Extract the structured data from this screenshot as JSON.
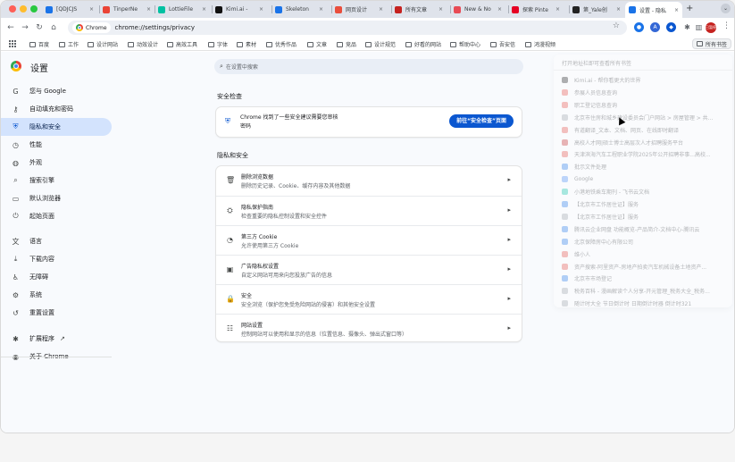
{
  "tabs": [
    {
      "label": "[QDJCJS",
      "color": "#1a73e8"
    },
    {
      "label": "TinperNe",
      "color": "#ea4335"
    },
    {
      "label": "LottieFile",
      "color": "#00c1a2"
    },
    {
      "label": "Kimi.ai -",
      "color": "#111111"
    },
    {
      "label": "Skeleton",
      "color": "#1a73e8"
    },
    {
      "label": "网页设计",
      "color": "#e94e3c"
    },
    {
      "label": "所有文章",
      "color": "#c5221f"
    },
    {
      "label": "New & No",
      "color": "#e84b55"
    },
    {
      "label": "探索 Pinte",
      "color": "#e60023"
    },
    {
      "label": "第_Yale创",
      "color": "#222222"
    },
    {
      "label": "设置 - 隐私",
      "color": "#1a73e8"
    }
  ],
  "toolbar": {
    "chip_label": "Chrome",
    "url": "chrome://settings/privacy",
    "profile_label": "已暂停",
    "extensions": [
      {
        "name": "extension-1-icon",
        "color": "#1a73e8",
        "glyph": "●"
      },
      {
        "name": "extension-2-icon",
        "color": "#3367d6",
        "glyph": "A"
      },
      {
        "name": "extension-3-icon",
        "color": "#0b57d0",
        "glyph": "◆"
      },
      {
        "name": "extension-puzzle-icon",
        "color": "#5f6368",
        "glyph": "✱"
      },
      {
        "name": "extension-sidepanel-icon",
        "color": "#5f6368",
        "glyph": "▥"
      }
    ]
  },
  "bookmarks": {
    "items": [
      "百度",
      "工作",
      "设计网站",
      "动效设计",
      "高效工具",
      "字体",
      "素材",
      "优秀作品",
      "文章",
      "竞品",
      "设计规范",
      "好看的网站",
      "帮助中心",
      "吾安信",
      "鸿漫视频"
    ],
    "all_label": "所有书签"
  },
  "page": {
    "title": "设置",
    "search_placeholder": "在设置中搜索",
    "nav": [
      {
        "label": "您与 Google",
        "icon": "G",
        "name": "sidebar-item-you-and-google",
        "active": false
      },
      {
        "label": "自动填充和密码",
        "icon": "⚷",
        "name": "sidebar-item-autofill",
        "active": false
      },
      {
        "label": "隐私和安全",
        "icon": "⛨",
        "name": "sidebar-item-privacy",
        "active": true
      },
      {
        "label": "性能",
        "icon": "◷",
        "name": "sidebar-item-performance",
        "active": false
      },
      {
        "label": "外观",
        "icon": "◍",
        "name": "sidebar-item-appearance",
        "active": false
      },
      {
        "label": "搜索引擎",
        "icon": "⌕",
        "name": "sidebar-item-search-engine",
        "active": false
      },
      {
        "label": "默认浏览器",
        "icon": "▭",
        "name": "sidebar-item-default-browser",
        "active": false
      },
      {
        "label": "起始页面",
        "icon": "⏻",
        "name": "sidebar-item-on-startup",
        "active": false
      },
      {
        "label": "语言",
        "icon": "文",
        "name": "sidebar-item-languages",
        "active": false
      },
      {
        "label": "下载内容",
        "icon": "⤓",
        "name": "sidebar-item-downloads",
        "active": false
      },
      {
        "label": "无障碍",
        "icon": "♿",
        "name": "sidebar-item-accessibility",
        "active": false
      },
      {
        "label": "系统",
        "icon": "⚙",
        "name": "sidebar-item-system",
        "active": false
      },
      {
        "label": "重置设置",
        "icon": "↺",
        "name": "sidebar-item-reset",
        "active": false
      },
      {
        "label": "扩展程序",
        "icon": "✱",
        "name": "sidebar-item-extensions",
        "active": false
      },
      {
        "label": "关于 Chrome",
        "icon": "◉",
        "name": "sidebar-item-about",
        "active": false
      }
    ],
    "safety_check": {
      "section_title": "安全检查",
      "line1": "Chrome 找到了一些安全建议需要您审核",
      "line2": "密码",
      "button": "前往“安全检查”页面"
    },
    "privacy": {
      "section_title": "隐私和安全",
      "rows": [
        {
          "title": "删除浏览数据",
          "subtitle": "删除历史记录、Cookie、缓存内容及其他数据",
          "icon": "🗑",
          "name": "row-clear-browsing-data"
        },
        {
          "title": "隐私保护指南",
          "subtitle": "检查重要的隐私控制设置和安全控件",
          "icon": "⛭",
          "name": "row-privacy-guide"
        },
        {
          "title": "第三方 Cookie",
          "subtitle": "允许使用第三方 Cookie",
          "icon": "◔",
          "name": "row-third-party-cookies"
        },
        {
          "title": "广告隐私权设置",
          "subtitle": "自定义网站可用来向您投放广告的信息",
          "icon": "▣",
          "name": "row-ad-privacy"
        },
        {
          "title": "安全",
          "subtitle": "安全浏览（保护您免受危险网站的侵害）和其他安全设置",
          "icon": "🔒",
          "name": "row-security"
        },
        {
          "title": "网站设置",
          "subtitle": "控制网站可以使用和显示的信息（位置信息、摄像头、弹出式窗口等）",
          "icon": "☷",
          "name": "row-site-settings"
        }
      ]
    }
  },
  "bookmark_dropdown": {
    "header": "打开地址栏即可查看所有书签",
    "items": [
      {
        "label": "Kimi.ai - 帮你看更大的世界",
        "color": "#111111"
      },
      {
        "label": "参展人员信息查询",
        "color": "#e8453c"
      },
      {
        "label": "职工登记信息查询",
        "color": "#e8453c"
      },
      {
        "label": "北京市住房和城乡建设委员会门户网站 > 房屋管理 > 共...",
        "color": "#9aa0a6"
      },
      {
        "label": "有道翻译_文本、文档、网页、在线即时翻译",
        "color": "#e8453c"
      },
      {
        "label": "高校人才网|硕士博士高层次人才招聘服务平台",
        "color": "#c5221f"
      },
      {
        "label": "天津滨海汽车工程职业学院2025年公开招聘非事...高校...",
        "color": "#e8453c"
      },
      {
        "label": "批示文件处理",
        "color": "#1a73e8"
      },
      {
        "label": "Google",
        "color": "#4285f4"
      },
      {
        "label": "小港地铁乘车期刊 - 飞书云文档",
        "color": "#00c1a2"
      },
      {
        "label": "【北京市工作居住证】服务",
        "color": "#1a73e8"
      },
      {
        "label": "【北京市工作居住证】服务",
        "color": "#9aa0a6"
      },
      {
        "label": "腾讯云企业网盘 功能概览-产品简介-文档中心-腾讯云",
        "color": "#1a73e8"
      },
      {
        "label": "北京保障房中心有限公司",
        "color": "#1a73e8"
      },
      {
        "label": "维小人",
        "color": "#e8453c"
      },
      {
        "label": "资产搜索-阿里资产-房地产拍卖汽车机械设备土地资产...",
        "color": "#e8453c"
      },
      {
        "label": "北京市市场登记",
        "color": "#1a73e8"
      },
      {
        "label": "税务百科 - 漫画解读个人分享-开元管理_税务大全_税务...",
        "color": "#9aa0a6"
      },
      {
        "label": "随计时大全 节日倒计时 日期倒计时器 倒计时321",
        "color": "#9aa0a6"
      }
    ]
  }
}
